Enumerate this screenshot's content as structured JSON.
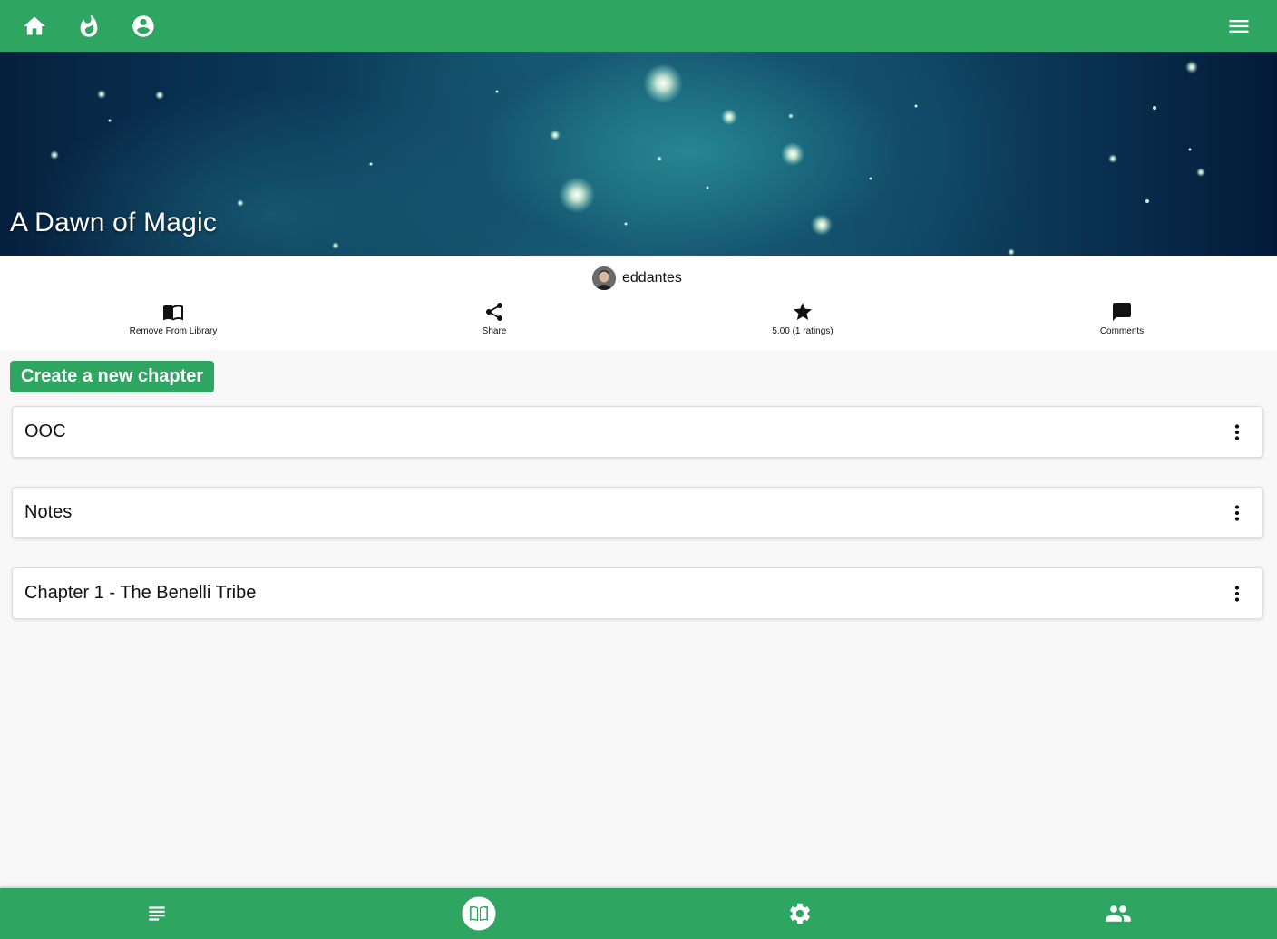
{
  "topbar": {
    "icons": [
      "home-icon",
      "whatshot-icon",
      "account-circle-icon"
    ],
    "menu_icon": "menu-icon",
    "color": "#2fa562"
  },
  "story": {
    "title": "A Dawn of Magic",
    "author": "eddantes"
  },
  "actions": [
    {
      "icon": "book-icon",
      "label": "Remove From Library"
    },
    {
      "icon": "share-icon",
      "label": "Share"
    },
    {
      "icon": "star-icon",
      "label": "5.00 (1 ratings)"
    },
    {
      "icon": "comment-icon",
      "label": "Comments"
    }
  ],
  "create_button": {
    "label": "Create a new chapter"
  },
  "chapters": [
    {
      "title": "OOC"
    },
    {
      "title": "Notes"
    },
    {
      "title": "Chapter 1 - The Benelli Tribe"
    }
  ],
  "bottom_nav": {
    "items": [
      "list-icon",
      "book-open-icon",
      "settings-icon",
      "people-icon"
    ],
    "active": "book-open-icon"
  }
}
